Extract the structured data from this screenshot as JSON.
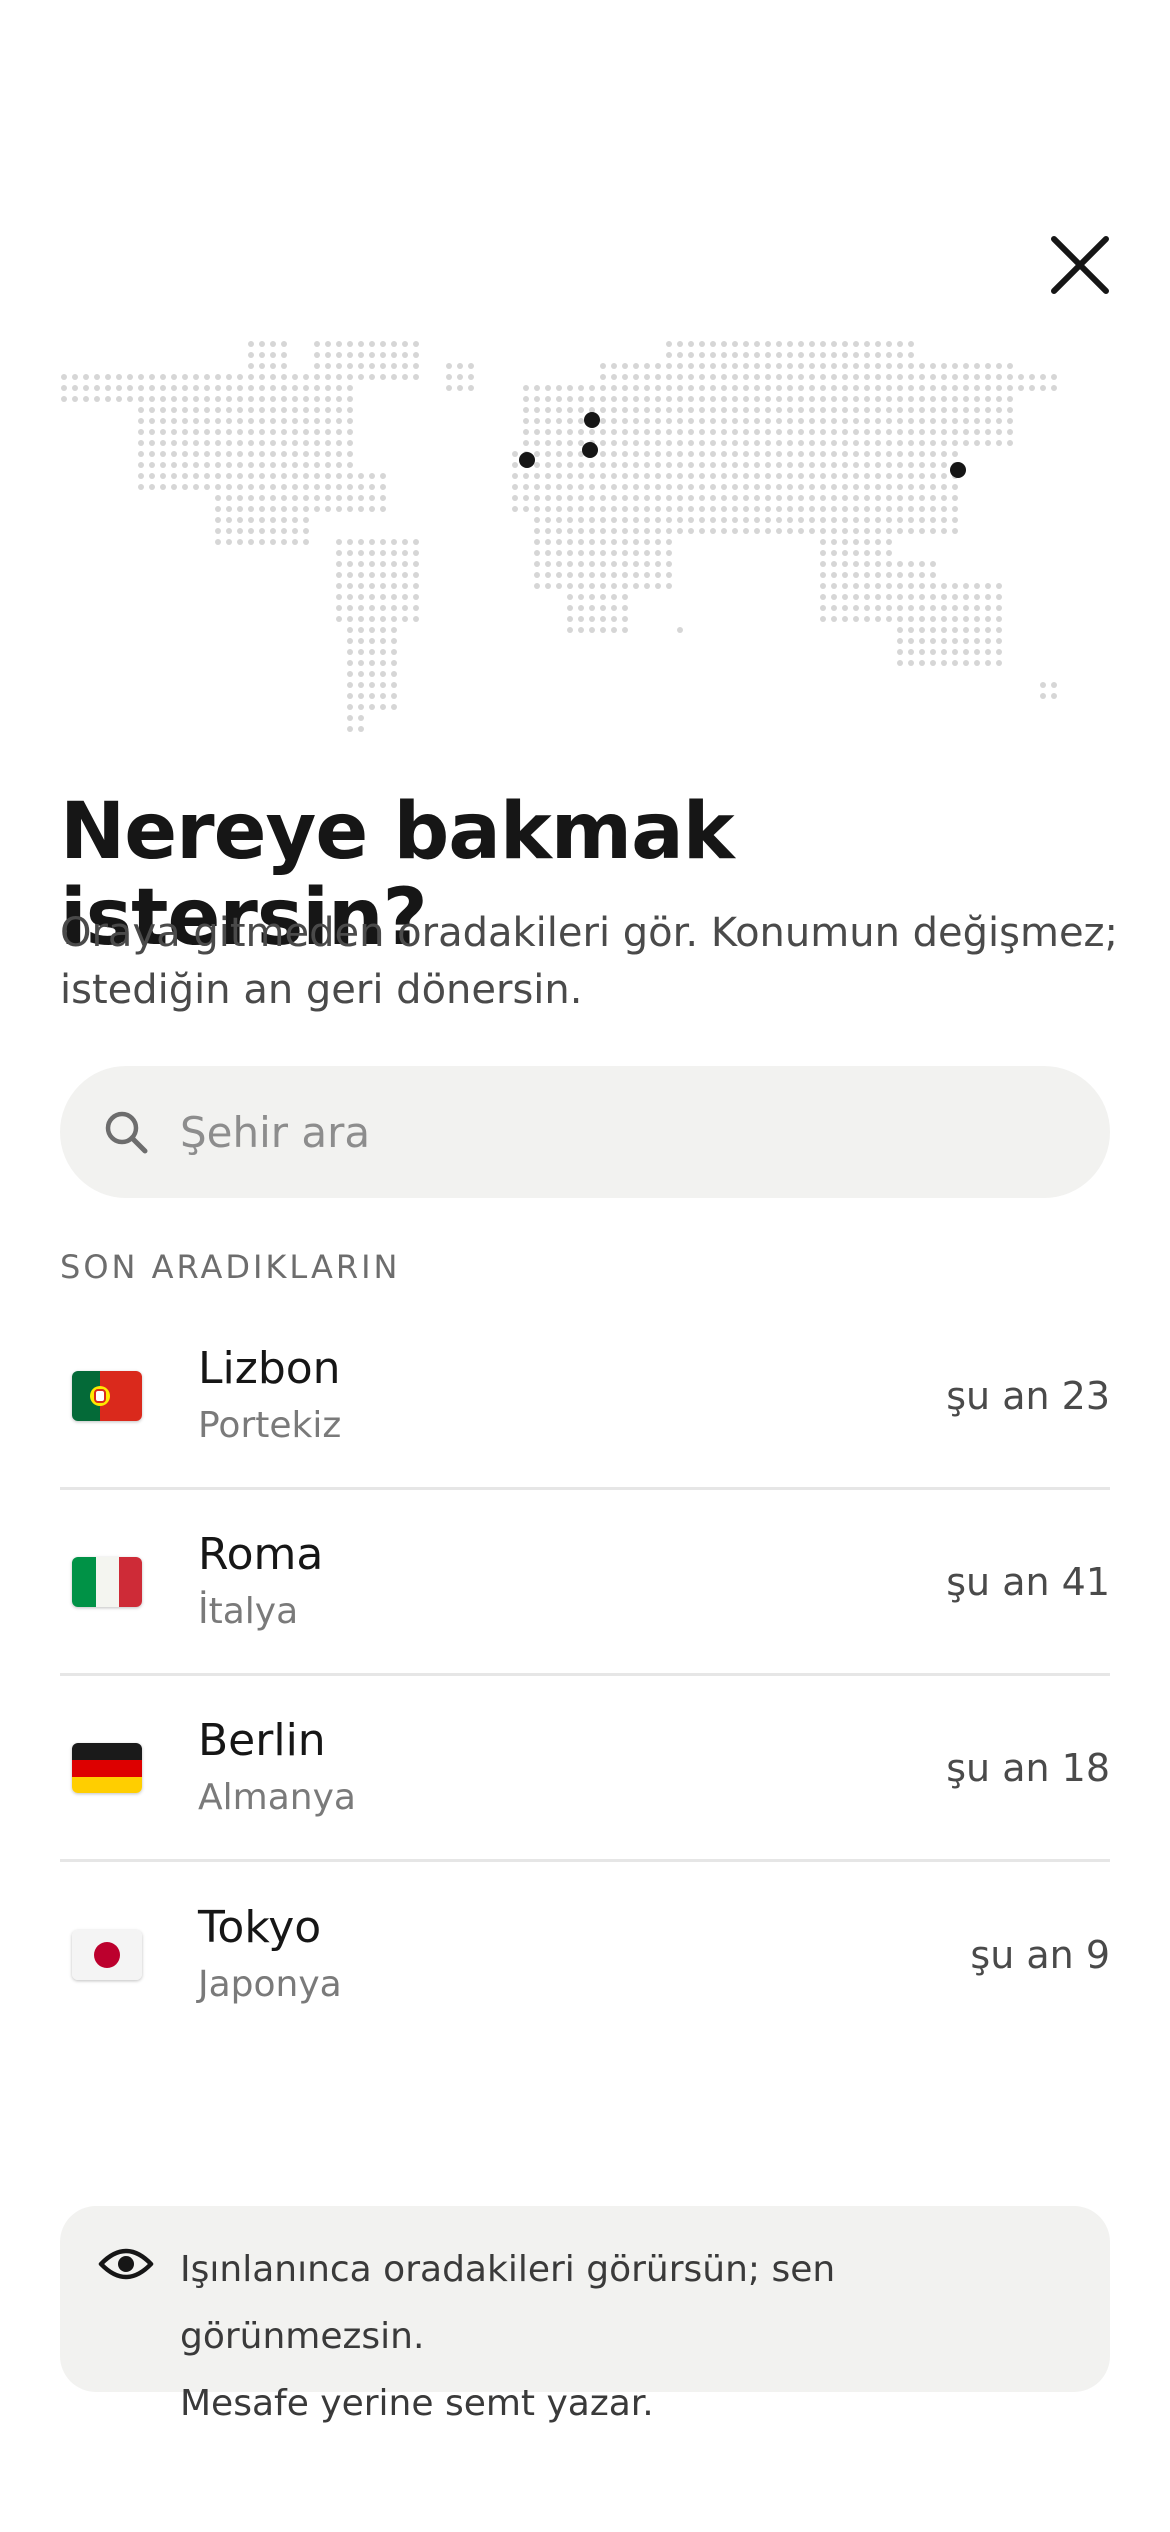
{
  "header": {
    "close_icon": "close-icon"
  },
  "hero": {
    "map_icon": "world-map-dotted",
    "title": "Nereye bakmak istersin?",
    "subtitle": "Oraya gitmeden oradakileri gör. Konumun değişmez; istediğin an geri dönersin."
  },
  "search": {
    "icon": "search-icon",
    "placeholder": "Şehir ara",
    "value": ""
  },
  "recent": {
    "label": "SON ARADIKLARIN",
    "items": [
      {
        "city": "Lizbon",
        "country": "Portekiz",
        "count": "şu an 23",
        "flag": "portugal-flag"
      },
      {
        "city": "Roma",
        "country": "İtalya",
        "count": "şu an 41",
        "flag": "italy-flag"
      },
      {
        "city": "Berlin",
        "country": "Almanya",
        "count": "şu an 18",
        "flag": "germany-flag"
      },
      {
        "city": "Tokyo",
        "country": "Japonya",
        "count": "şu an 9",
        "flag": "japan-flag"
      }
    ]
  },
  "notice": {
    "icon": "eye-icon",
    "line1": "Işınlanınca oradakileri görürsün; sen görünmezsin.",
    "line2": "Mesafe yerine semt yazar."
  },
  "colors": {
    "text": "#161616",
    "muted": "#7a7a7a",
    "surface": "#f2f2f0",
    "map_dot": "#d6d6d6",
    "accent_dot": "#161616"
  }
}
